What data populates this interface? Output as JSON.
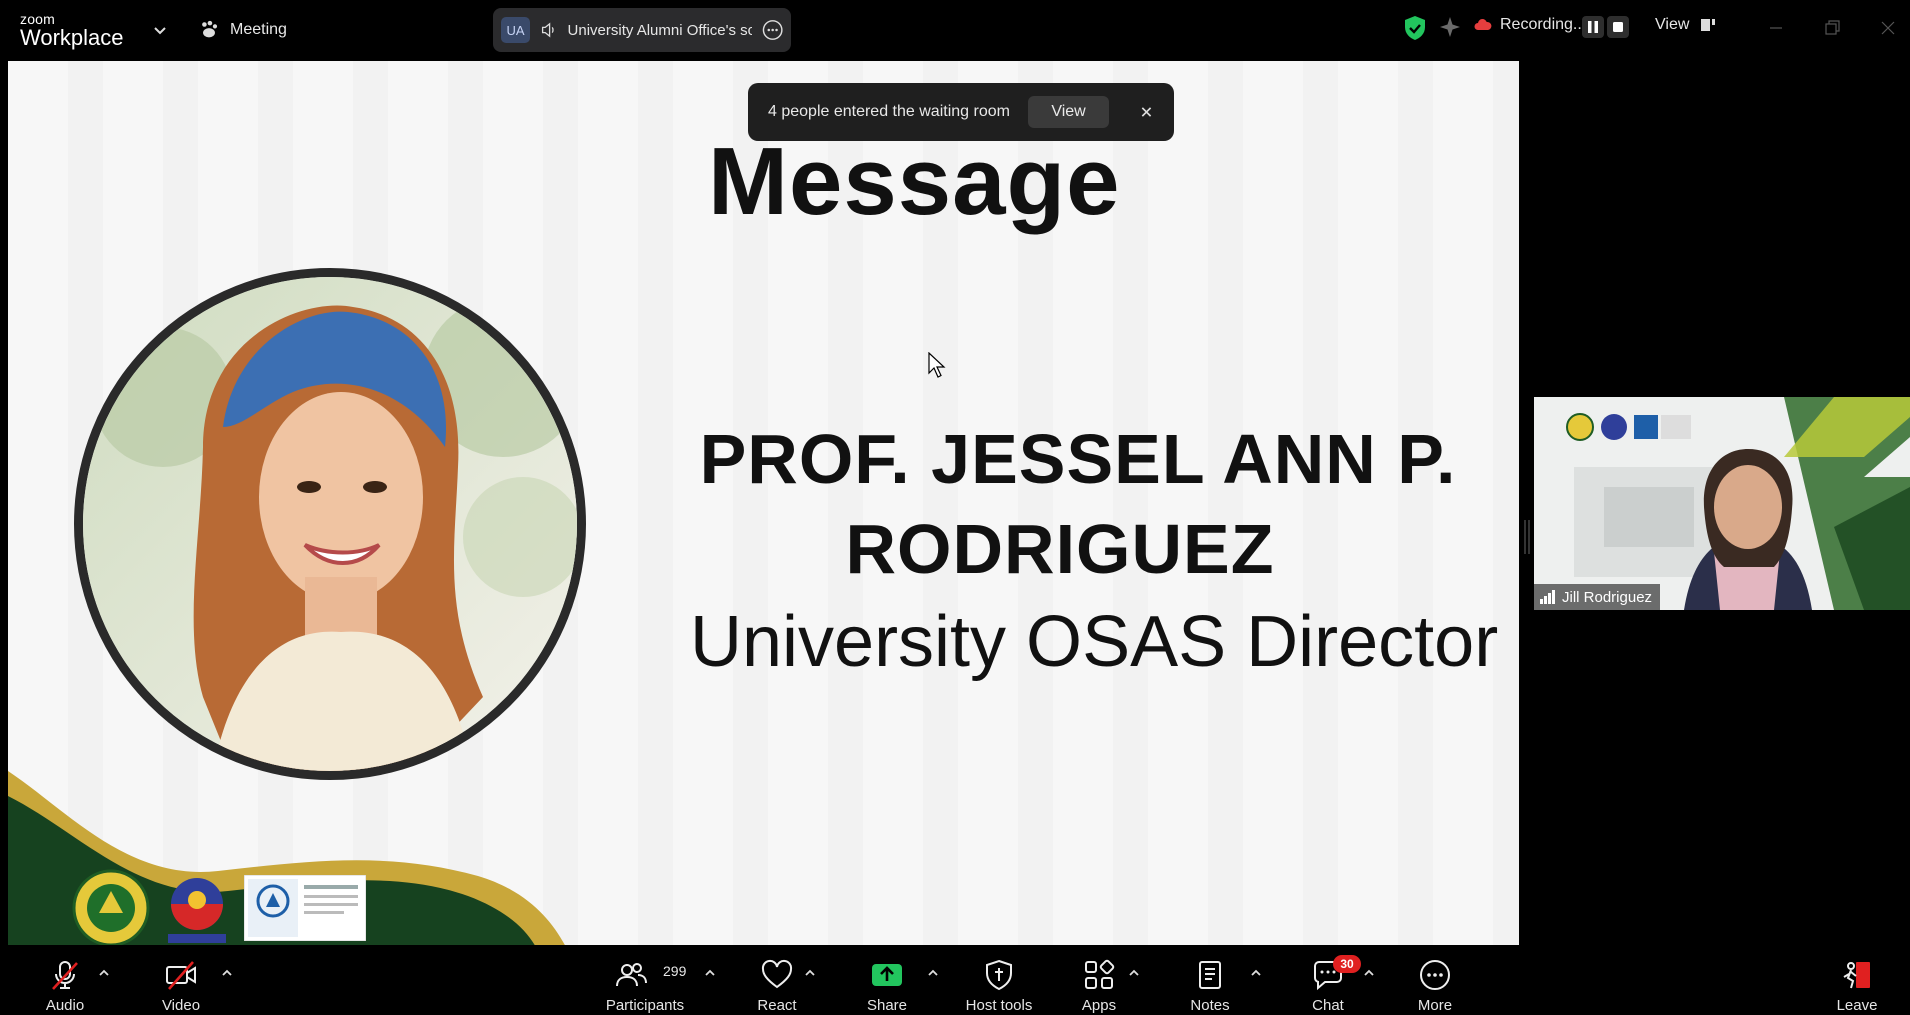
{
  "app": {
    "brand_top": "zoom",
    "brand_bottom": "Workplace"
  },
  "header": {
    "meeting_label": "Meeting",
    "share_initials": "UA",
    "share_title": "University Alumni Office's scr",
    "recording_label": "Recording...",
    "view_label": "View"
  },
  "toast": {
    "text": "4 people entered the waiting room",
    "view_label": "View"
  },
  "slide": {
    "title": "Message",
    "name_line1": "PROF. JESSEL ANN P.",
    "name_line2": "RODRIGUEZ",
    "role": "University OSAS Director"
  },
  "participant_tile": {
    "name": "Jill Rodriguez"
  },
  "toolbar": {
    "audio": "Audio",
    "video": "Video",
    "participants": "Participants",
    "participants_count": "299",
    "react": "React",
    "share": "Share",
    "host_tools": "Host tools",
    "apps": "Apps",
    "notes": "Notes",
    "chat": "Chat",
    "chat_badge": "30",
    "more": "More",
    "leave": "Leave"
  },
  "colors": {
    "background": "#000000",
    "share_green": "#22c55e",
    "alert_red": "#e02020",
    "slide_green": "#16421f",
    "slide_gold": "#c9a73a"
  }
}
